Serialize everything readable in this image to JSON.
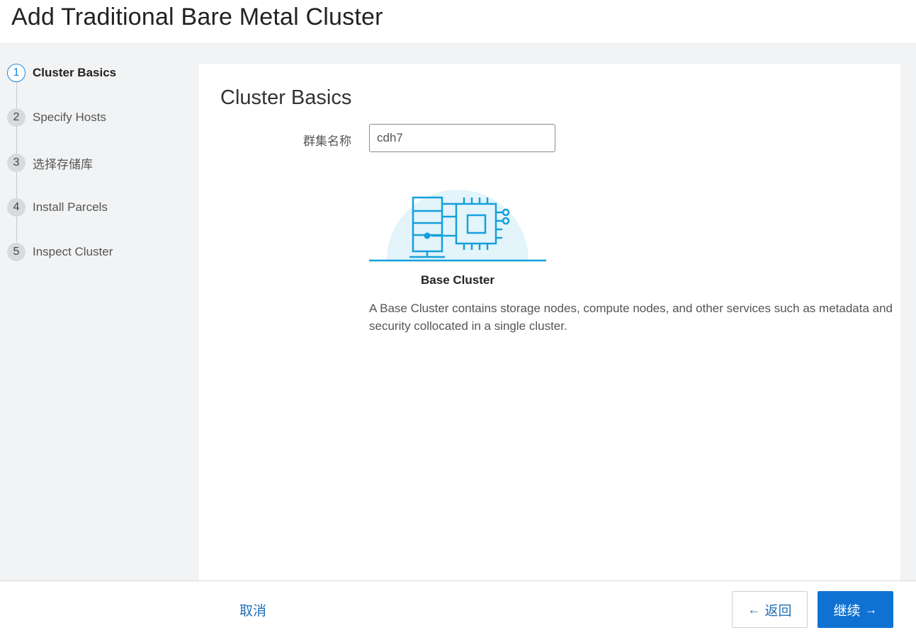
{
  "header": {
    "title": "Add Traditional Bare Metal Cluster"
  },
  "steps": [
    {
      "number": "1",
      "label": "Cluster Basics",
      "active": true
    },
    {
      "number": "2",
      "label": "Specify Hosts",
      "active": false
    },
    {
      "number": "3",
      "label": "选择存储库",
      "active": false
    },
    {
      "number": "4",
      "label": "Install Parcels",
      "active": false
    },
    {
      "number": "5",
      "label": "Inspect Cluster",
      "active": false
    }
  ],
  "panel": {
    "title": "Cluster Basics",
    "cluster_name_label": "群集名称",
    "cluster_name_value": "cdh7",
    "card_icon": "server-cpu-illustration",
    "card_title": "Base Cluster",
    "card_description": "A Base Cluster contains storage nodes, compute nodes, and other services such as metadata and security collocated in a single cluster."
  },
  "footer": {
    "cancel_label": "取消",
    "back_label": "返回",
    "next_label": "继续",
    "back_icon": "arrow-left-icon",
    "next_icon": "arrow-right-icon"
  },
  "colors": {
    "accent": "#0f72d2",
    "link": "#1f6fb5",
    "illustration": "#14a0dc",
    "illustration_bg": "#e3f4fb",
    "sidebar_bg": "#f2f3f4"
  }
}
